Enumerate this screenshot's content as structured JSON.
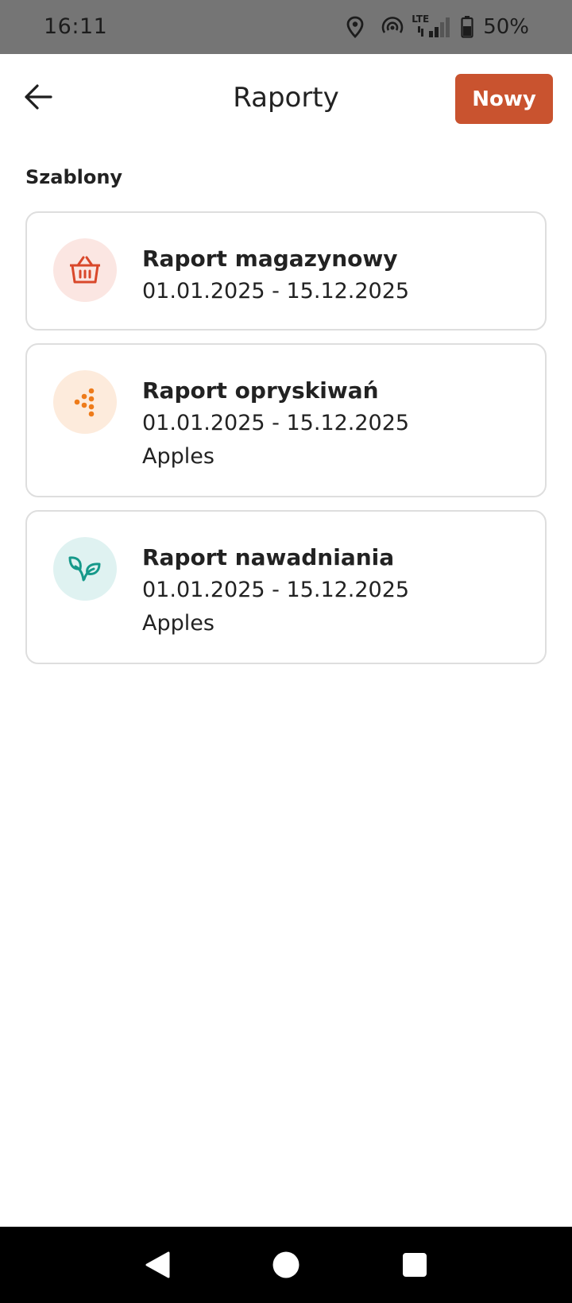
{
  "status_bar": {
    "time": "16:11",
    "icons": [
      "location-icon",
      "hotspot-icon",
      "lte-signal-icon",
      "battery-icon"
    ],
    "network_label": "LTE",
    "battery_percent": "50%"
  },
  "app_bar": {
    "back_icon": "arrow-left-icon",
    "title": "Raporty",
    "new_button_label": "Nowy"
  },
  "section": {
    "label": "Szablony"
  },
  "templates": [
    {
      "title": "Raport magazynowy",
      "date_range": "01.01.2025 - 15.12.2025",
      "icon": "basket-icon",
      "icon_color": "#d9482b",
      "icon_bg": "#fbe6e2"
    },
    {
      "title": "Raport opryskiwań",
      "date_range": "01.01.2025 - 15.12.2025",
      "crop": "Apples",
      "icon": "spray-dots-icon",
      "icon_color": "#ee7b1a",
      "icon_bg": "#fdebdc"
    },
    {
      "title": "Raport nawadniania",
      "date_range": "01.01.2025 - 15.12.2025",
      "crop": "Apples",
      "icon": "sprout-icon",
      "icon_color": "#16998a",
      "icon_bg": "#dff2f1"
    }
  ],
  "colors": {
    "accent": "#c9532f",
    "status_bar_bg": "#757575",
    "nav_bar_bg": "#000000"
  },
  "nav_bar": {
    "buttons": [
      "back-triangle-icon",
      "home-circle-icon",
      "recents-square-icon"
    ]
  }
}
